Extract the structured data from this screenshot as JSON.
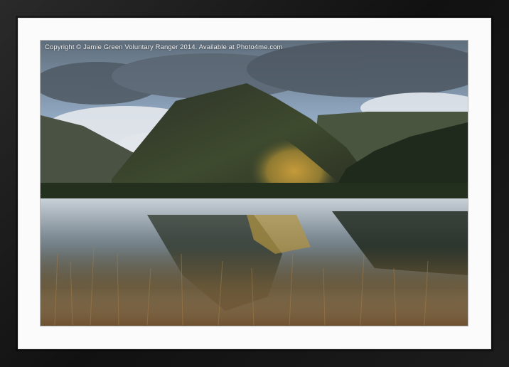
{
  "photo": {
    "copyright": "Copyright © Jamie Green Voluntary Ranger 2014. Available at Photo4me.com",
    "subject": "mountain-lake-landscape"
  },
  "frame": {
    "color": "#1a1a1a",
    "mount_color": "#fbfbfb"
  }
}
